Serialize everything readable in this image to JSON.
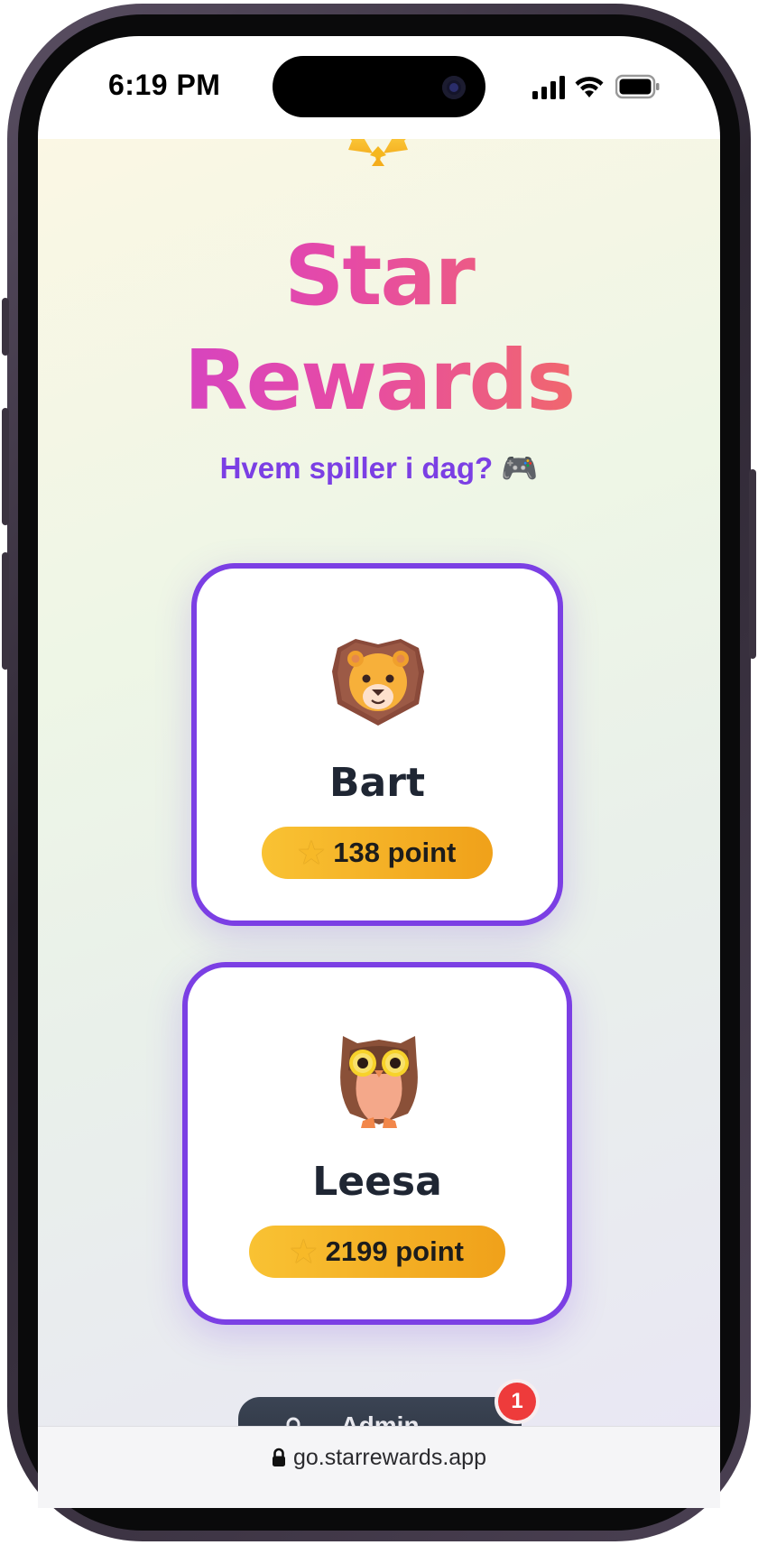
{
  "status_bar": {
    "time": "6:19 PM"
  },
  "app": {
    "title_line1": "Star",
    "title_line2": "Rewards",
    "subtitle": "Hvem spiller i dag? 🎮",
    "gradient_colors": [
      "#c93fd6",
      "#e64aa6",
      "#f77a4a"
    ],
    "accent_color": "#7b3fe4",
    "points_pill_color": "#f9c233"
  },
  "players": [
    {
      "name": "Bart",
      "avatar": "lion-face-icon",
      "points_label": "138 point",
      "points": 138
    },
    {
      "name": "Leesa",
      "avatar": "owl-icon",
      "points_label": "2199 point",
      "points": 2199
    }
  ],
  "bottom_button": {
    "label": "Admin",
    "badge_count": "1"
  },
  "browser": {
    "url": "go.starrewards.app"
  }
}
